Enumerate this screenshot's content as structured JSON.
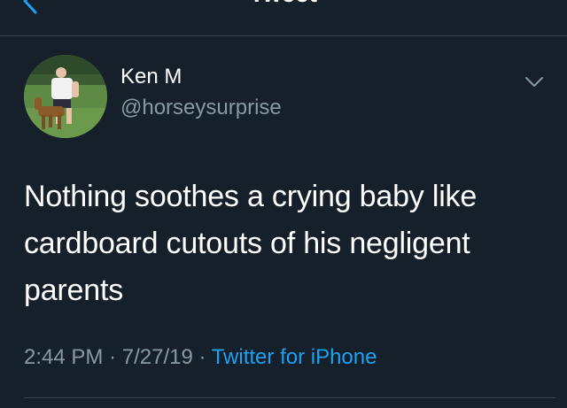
{
  "header": {
    "title": "Tweet",
    "back_icon": "chevron-left-icon"
  },
  "author": {
    "display_name": "Ken M",
    "handle": "@horseysurprise",
    "avatar_icon": "avatar-photo"
  },
  "tweet": {
    "text": "Nothing soothes a crying baby like cardboard cutouts of his negligent parents",
    "time": "2:44 PM",
    "date": "7/27/19",
    "separator": "·",
    "source": "Twitter for iPhone"
  },
  "menu": {
    "more_icon": "chevron-down-icon"
  },
  "colors": {
    "background": "#15202b",
    "divider": "#38444d",
    "accent": "#1da1f2",
    "secondary_text": "#8899a6",
    "primary_text": "#ffffff"
  }
}
